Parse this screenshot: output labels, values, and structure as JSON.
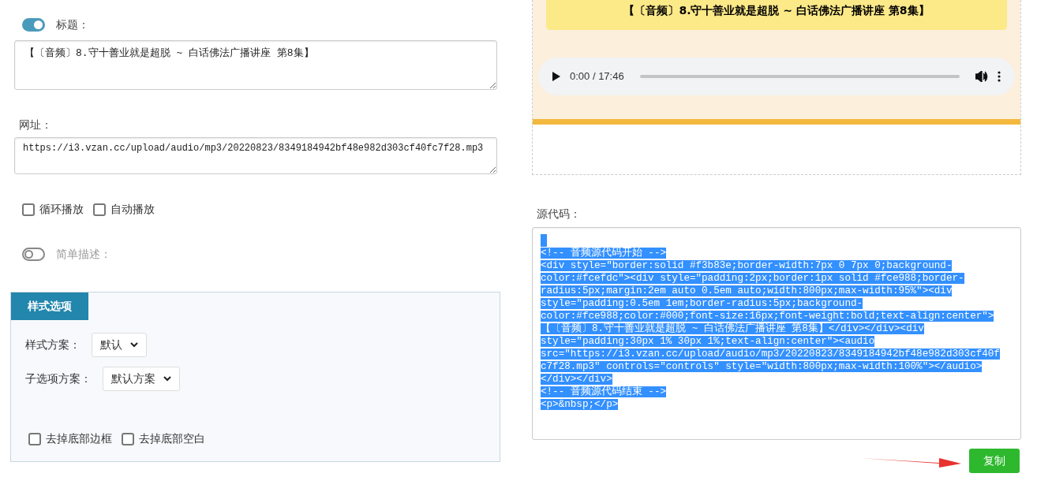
{
  "title_field": {
    "label": "标题：",
    "on": true,
    "value": "【〔音频〕8.守十善业就是超脱 ~ 白话佛法广播讲座 第8集】"
  },
  "url_field": {
    "label": "网址：",
    "value": "https://i3.vzan.cc/upload/audio/mp3/20220823/8349184942bf48e982d303cf40fc7f28.mp3"
  },
  "play_options": [
    {
      "label": "循环播放",
      "checked": false
    },
    {
      "label": "自动播放",
      "checked": false
    }
  ],
  "description_toggle": {
    "label": "简单描述：",
    "on": false
  },
  "style_panel": {
    "tab": "样式选项",
    "selects": [
      {
        "label": "样式方案：",
        "value": "默认"
      },
      {
        "label": "子选项方案：",
        "value": "默认方案"
      }
    ],
    "options": [
      {
        "label": "去掉底部边框",
        "checked": false
      },
      {
        "label": "去掉底部空白",
        "checked": false
      }
    ]
  },
  "preview": {
    "heading": "【〔音频〕8.守十善业就是超脱 ~ 白话佛法广播讲座 第8集】",
    "player_time": "0:00 / 17:46"
  },
  "source_code": {
    "label": "源代码：",
    "lines": [
      "<!-- 音频源代码开始 -->",
      "<div style=\"border:solid #f3b83e;border-width:7px 0 7px 0;background-",
      "color:#fcefdc\"><div style=\"padding:2px;border:1px solid #fce988;border-",
      "radius:5px;margin:2em auto 0.5em auto;width:800px;max-width:95%\"><div",
      "style=\"padding:0.5em 1em;border-radius:5px;background-",
      "color:#fce988;color:#000;font-size:16px;font-weight:bold;text-align:center\">",
      "【〔音频〕8.守十善业就是超脱 ~ 白话佛法广播讲座 第8集】</div></div><div",
      "style=\"padding:30px 1% 30px 1%;text-align:center\"><audio",
      "src=\"https://i3.vzan.cc/upload/audio/mp3/20220823/8349184942bf48e982d303cf40f",
      "c7f28.mp3\" controls=\"controls\" style=\"width:800px;max-width:100%\"></audio>",
      "</div></div>",
      "<!-- 音频源代码结束 -->",
      "<p>&nbsp;</p>"
    ],
    "selected": true
  },
  "copy_button": "复制"
}
